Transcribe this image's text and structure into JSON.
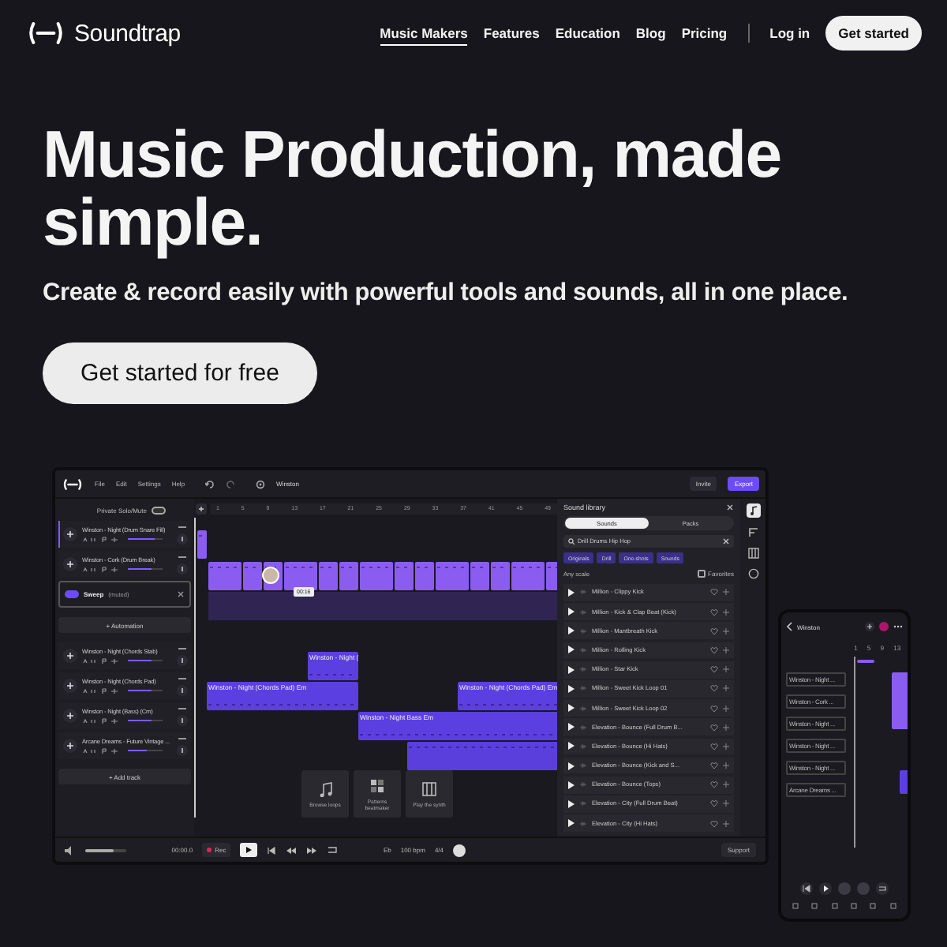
{
  "nav": {
    "logo": "Soundtrap",
    "links": [
      {
        "label": "Music Makers",
        "selected": true
      },
      {
        "label": "Features",
        "selected": false
      },
      {
        "label": "Education",
        "selected": false
      },
      {
        "label": "Blog",
        "selected": false
      },
      {
        "label": "Pricing",
        "selected": false
      }
    ],
    "login": "Log in",
    "cta": "Get started"
  },
  "hero": {
    "title": "Music Production, made simple.",
    "subtitle": "Create & record easily with powerful tools and sounds, all in one place.",
    "cta": "Get started for free"
  },
  "app": {
    "menu": [
      "File",
      "Edit",
      "Settings",
      "Help"
    ],
    "project": "Winston",
    "invite": "Invite",
    "export": "Export",
    "solo_mute": {
      "label": "Private Solo/Mute",
      "on": false
    },
    "tracks": [
      {
        "kind": "track",
        "name": "Winston - Night (Drum Snare Fill)",
        "level": 0.75,
        "selected": true
      },
      {
        "kind": "track",
        "name": "Winston - Cork (Drum Break)",
        "level": 0.7,
        "selected": false
      },
      {
        "kind": "automation",
        "name": "Sweep",
        "value": "(muted)",
        "on": true
      },
      {
        "kind": "add",
        "label": "+ Automation"
      },
      {
        "kind": "track",
        "name": "Winston - Night (Chords Stab)",
        "level": 0.7,
        "selected": false
      },
      {
        "kind": "track",
        "name": "Winston - Night (Chords Pad)",
        "level": 0.7,
        "selected": false
      },
      {
        "kind": "track",
        "name": "Winston - Night (Bass) (Cm)",
        "level": 0.7,
        "selected": false
      },
      {
        "kind": "track",
        "name": "Arcane Dreams - Future Vintage ...",
        "level": 0.55,
        "selected": false
      }
    ],
    "add_track": "+ Add track",
    "ruler": [
      "1",
      "5",
      "9",
      "13",
      "17",
      "21",
      "25",
      "29",
      "33",
      "37",
      "41",
      "45",
      "49"
    ],
    "clip_labels": [
      "Winston - Night (",
      "Winston - Night (Chords Pad) Em",
      "Winston - Night (Chords Pad) Em",
      "Winston - Night Bass Em"
    ],
    "tooltip": "00:16",
    "tiles": [
      "Browse loops",
      "Patterns beatmaker",
      "Play the synth"
    ],
    "library": {
      "title": "Sound library",
      "tabs": [
        {
          "label": "Sounds",
          "selected": true
        },
        {
          "label": "Packs",
          "selected": false
        }
      ],
      "search": "Drill Drums Hip Hop",
      "chips": [
        "Originals",
        "Drill",
        "One-shots",
        "Sounds"
      ],
      "scale": "Any scale",
      "favorites": {
        "label": "Favorites",
        "checked": false
      },
      "items": [
        "Million - Clippy Kick",
        "Million - Kick & Clap Beat (Kick)",
        "Million - Mantbreath Kick",
        "Million - Rolling Kick",
        "Million - Star Kick",
        "Million - Sweet Kick Loop 01",
        "Million - Sweet Kick Loop 02",
        "Elevation - Bounce (Full Drum B...",
        "Elevation - Bounce (Hi Hats)",
        "Elevation - Bounce (Kick and S...",
        "Elevation - Bounce (Tops)",
        "Elevation - City (Full Drum Beat)",
        "Elevation - City (Hi Hats)"
      ]
    },
    "transport": {
      "volume": {
        "level": 0.7
      },
      "time": "00:00.0",
      "rec": "Rec",
      "key": "Eb",
      "bpm": "100",
      "bpm_unit": "bpm",
      "meter": "4/4",
      "support": "Support"
    }
  },
  "phone": {
    "title": "Winston",
    "ruler": [
      "1",
      "5",
      "9",
      "13"
    ],
    "tracks": [
      "Winston - Night ...",
      "Winston - Cork ...",
      "Winston - Night ...",
      "Winston - Night ...",
      "Winston - Night ...",
      "Arcane Dreams ..."
    ]
  }
}
